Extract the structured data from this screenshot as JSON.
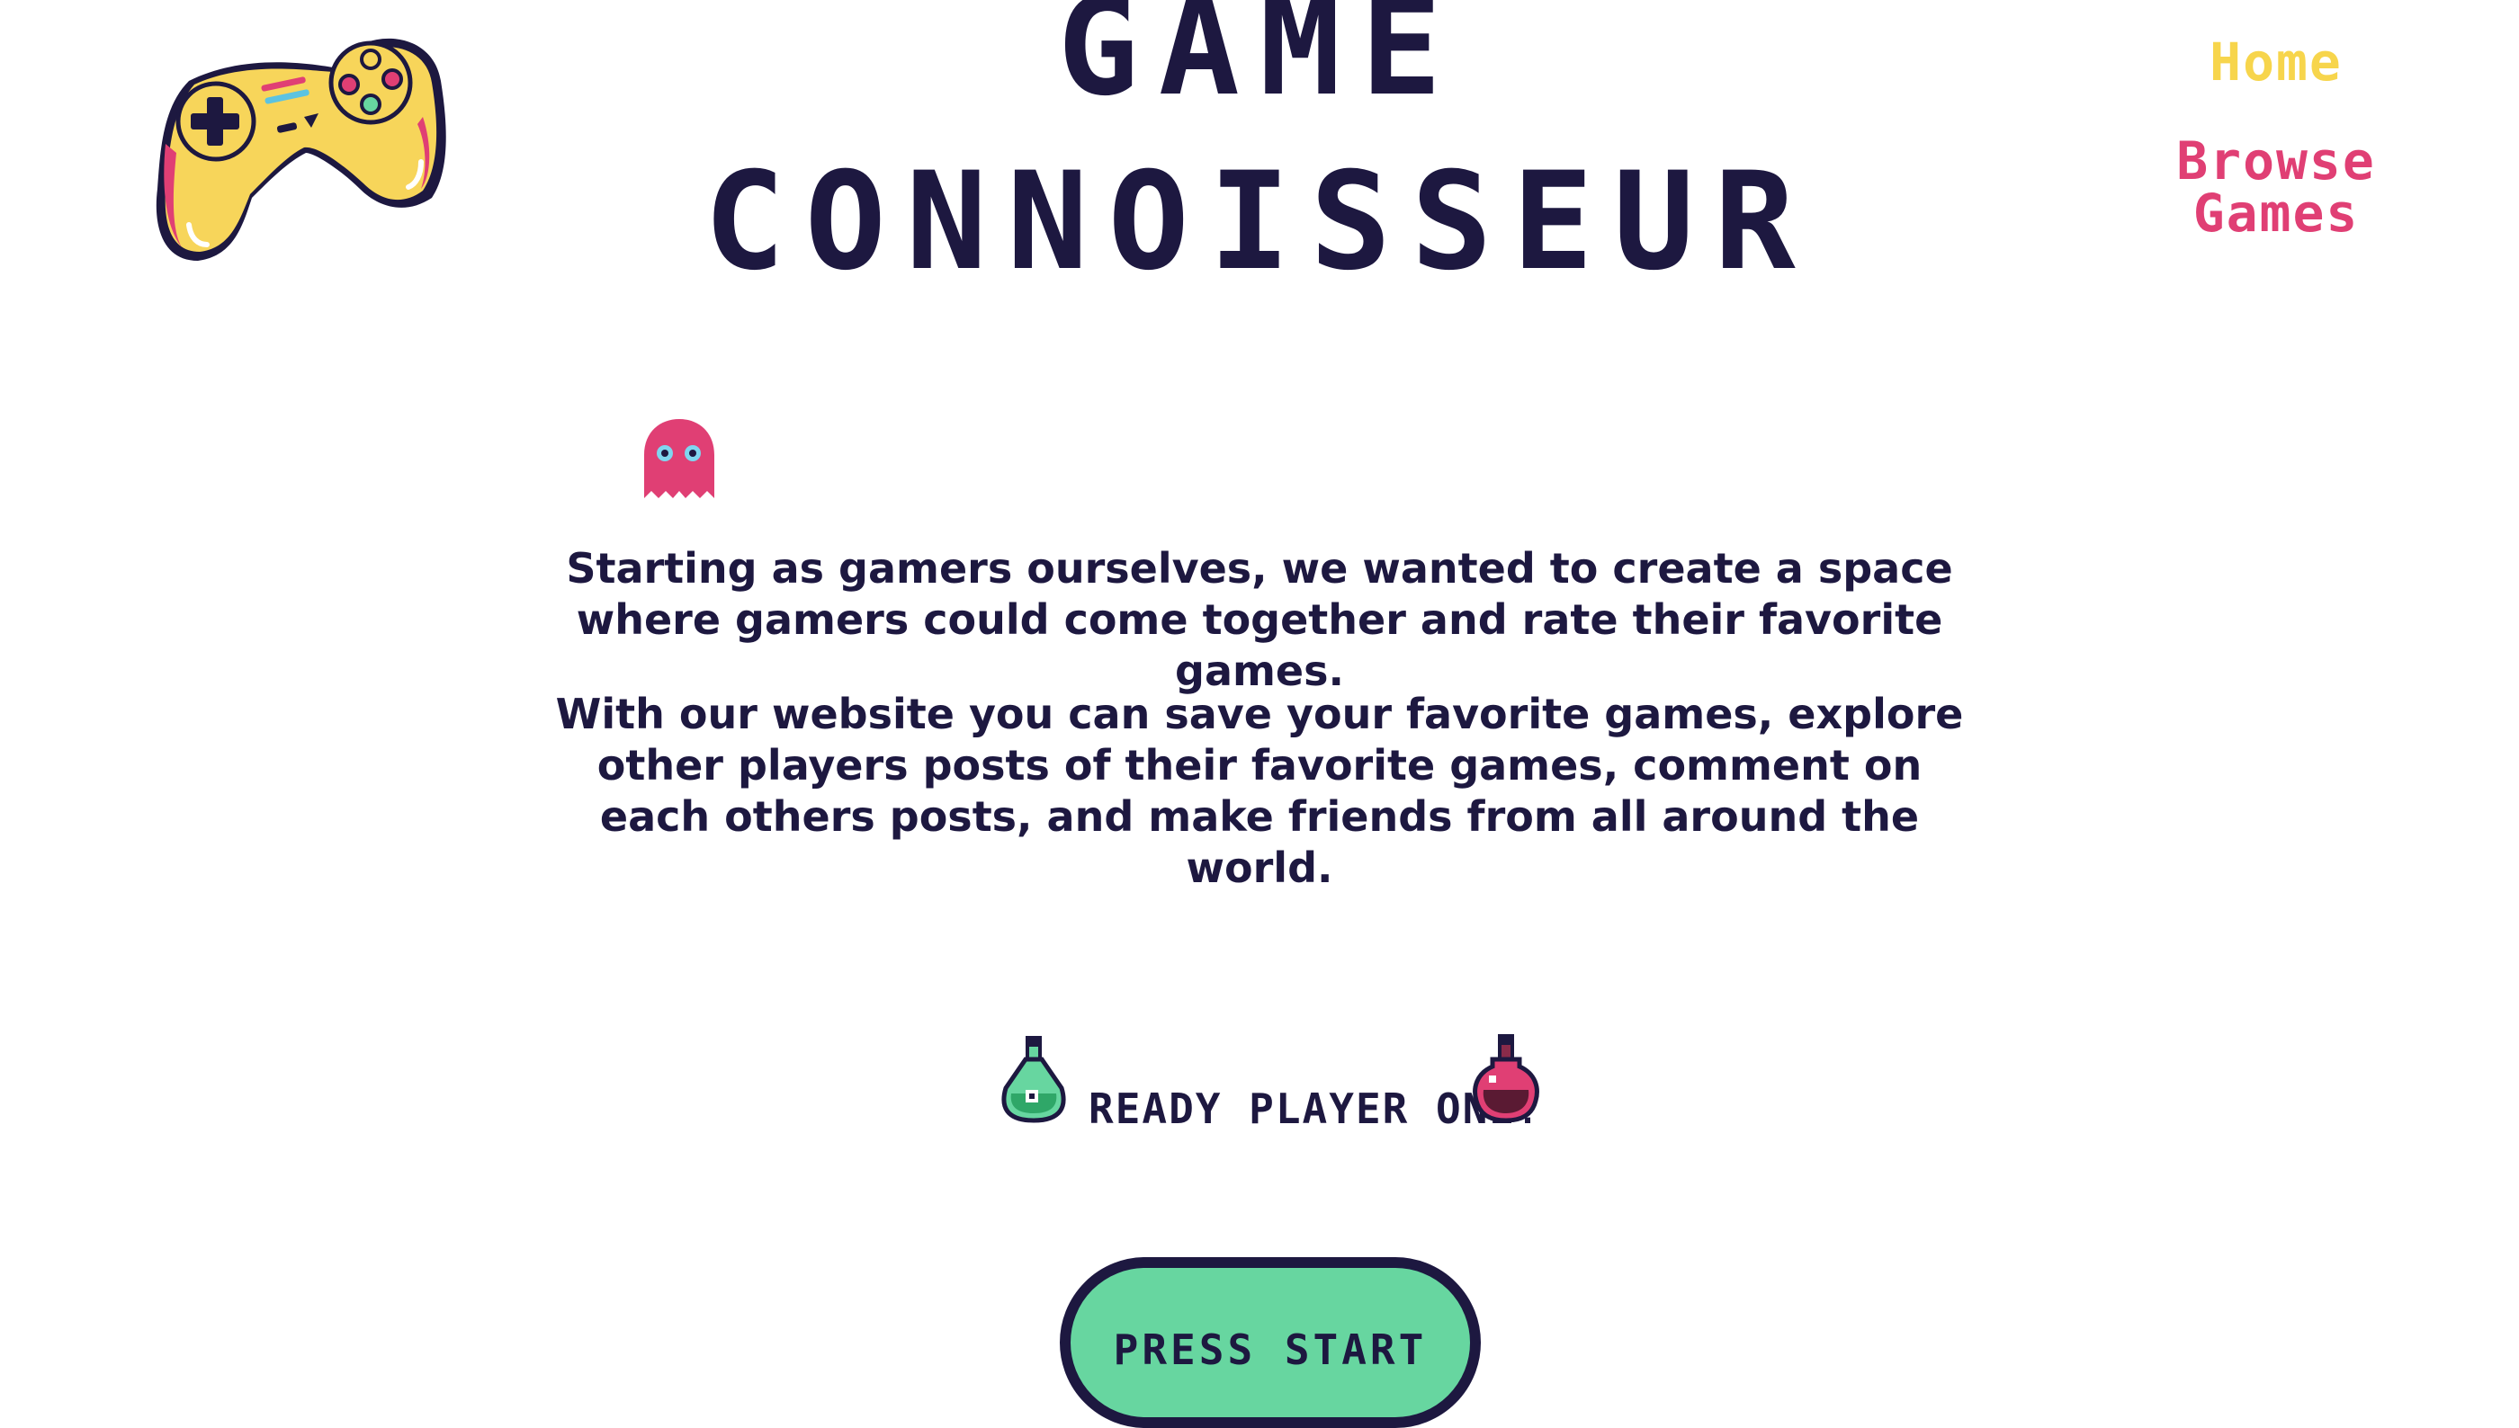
{
  "header": {
    "title_line_1": "GAME",
    "title_line_2": "CONNOISSEUR"
  },
  "logo": {
    "icon": "game-controller-icon"
  },
  "nav": {
    "items": [
      {
        "label": "Home",
        "color": "#f7d54c"
      },
      {
        "label": "Browse Games",
        "color": "#e03f74"
      }
    ]
  },
  "main": {
    "ghost_icon": "ghost-icon",
    "paragraphs": [
      "Starting as gamers ourselves, we wanted to create a space where gamers could come together and rate their favorite games.",
      "With our website you can save your favorite games, explore other players posts of their favorite games, comment on each others posts, and make friends from all around the world."
    ],
    "ready_text": "READY PLAYER ONE?",
    "left_icon": "green-potion-icon",
    "right_icon": "red-potion-icon",
    "start_button_label": "PRESS START"
  },
  "colors": {
    "text": "#1d1840",
    "accent_yellow": "#f7d54c",
    "accent_pink": "#e03f74",
    "button_green": "#67d6a0"
  }
}
